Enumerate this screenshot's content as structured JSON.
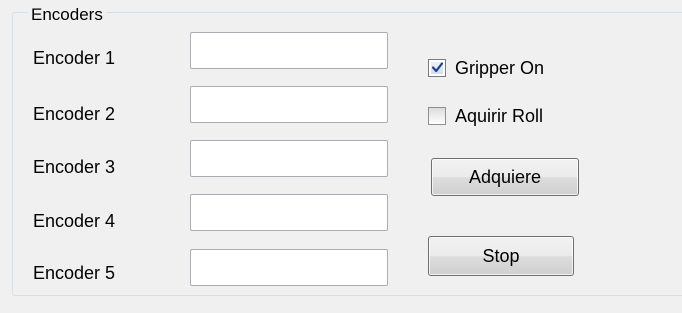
{
  "group": {
    "title": "Encoders"
  },
  "encoders": [
    {
      "label": "Encoder 1",
      "value": ""
    },
    {
      "label": "Encoder 2",
      "value": ""
    },
    {
      "label": "Encoder 3",
      "value": ""
    },
    {
      "label": "Encoder 4",
      "value": ""
    },
    {
      "label": "Encoder 5",
      "value": ""
    }
  ],
  "options": {
    "gripper_on": {
      "label": "Gripper On",
      "checked": true
    },
    "aquirir_roll": {
      "label": "Aquirir Roll",
      "checked": false
    }
  },
  "buttons": {
    "adquiere": "Adquiere",
    "stop": "Stop"
  },
  "colors": {
    "panel_background": "#f0f0f0",
    "group_border": "#d5dfe5",
    "textbox_border": "#abadb3",
    "checkmark": "#1d3e8e"
  }
}
